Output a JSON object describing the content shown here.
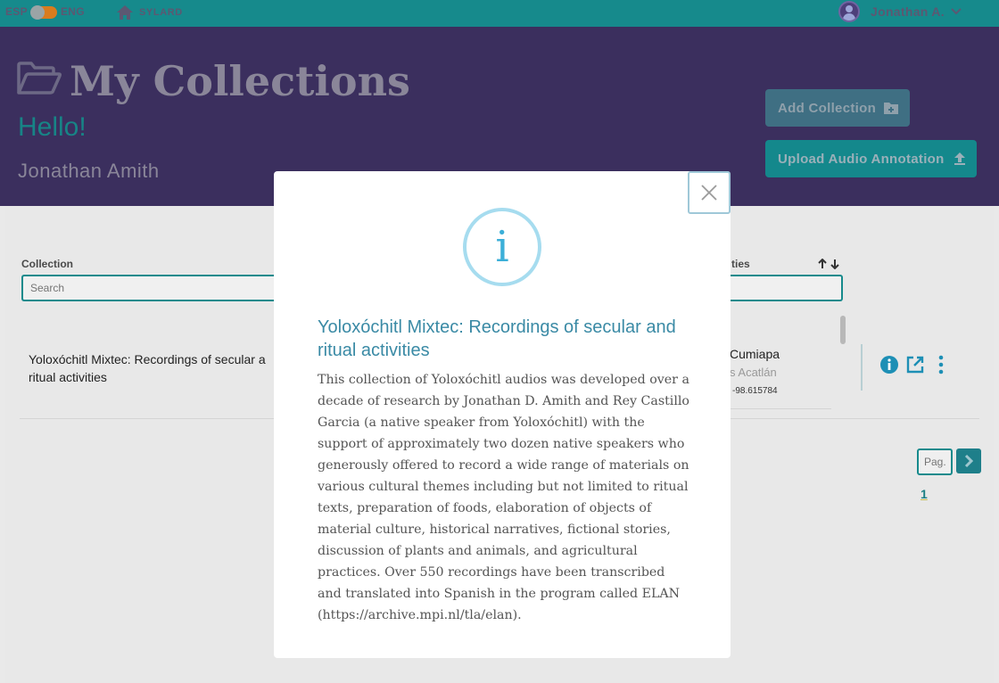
{
  "topbar": {
    "lang_left": "ESP",
    "lang_right": "ENG",
    "home_label": "SYLARD",
    "user_short": "Jonathan A."
  },
  "header": {
    "title": "My Collections",
    "greeting": "Hello!",
    "user_fullname": "Jonathan Amith",
    "add_collection_label": "Add Collection",
    "upload_label": "Upload Audio Annotation"
  },
  "table": {
    "col_collection": "Collection",
    "col_activities": "ties",
    "search_placeholder": "Search",
    "rows": [
      {
        "title": "Yoloxóchitl Mixtec: Recordings of secular and ritual activities",
        "title_visible": "Yoloxóchitl Mixtec: Recordings of secular a ritual activities",
        "place": "Cumiapa",
        "place_sub": "s Acatlán",
        "coords": "-98.615784"
      }
    ]
  },
  "pagination": {
    "page_placeholder": "Pag.",
    "current_page": "1"
  },
  "modal": {
    "title": "Yoloxóchitl Mixtec: Recordings of secular and ritual activities",
    "body": "This collection of Yoloxóchitl audios was developed over a decade of research by Jonathan D. Amith and Rey Castillo Garcia (a native speaker from Yoloxóchitl) with the support of approximately two dozen native speakers who generously offered to record a wide range of materials on various cultural themes including but not limited to ritual texts, preparation of foods, elaboration of objects of material culture, historical narratives, fictional stories, discussion of plants and animals, and agricultural practices. Over 550 recordings have been transcribed and translated into Spanish in the program called ELAN (https://archive.mpi.nl/tla/elan)."
  },
  "colors": {
    "topbar": "#168a8c",
    "header": "#3b2f5e",
    "accent": "#14888c",
    "info_icon": "#1d8fb5",
    "modal_title": "#3a8aa5"
  },
  "icons": {
    "home": "home-icon",
    "folder": "folder-open-icon",
    "add": "folder-plus-icon",
    "upload": "upload-icon",
    "info": "info-icon",
    "open": "external-link-icon",
    "more": "more-vertical-icon",
    "close": "close-icon",
    "next": "chevron-right-icon",
    "user": "user-avatar-icon",
    "dropdown": "chevron-down-icon"
  }
}
